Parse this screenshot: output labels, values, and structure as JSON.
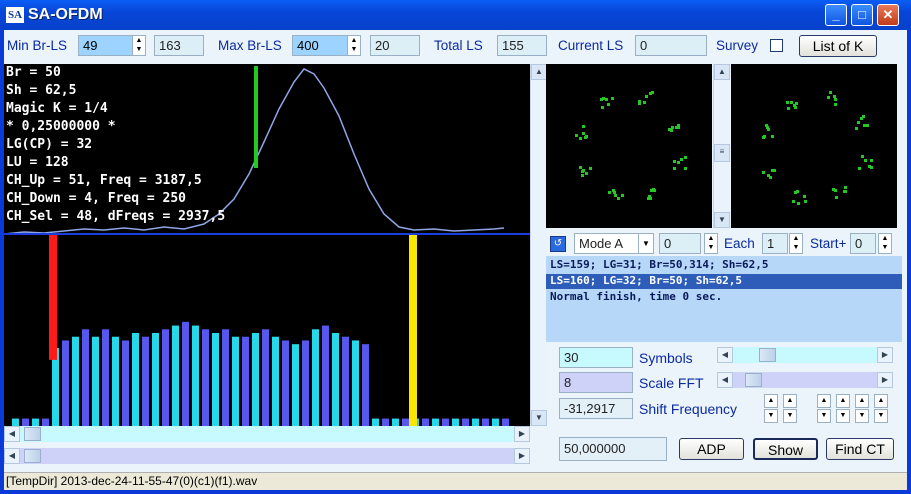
{
  "window": {
    "title": "SA-OFDM",
    "icon_text": "SA",
    "min": "_",
    "max": "□",
    "close": "✕"
  },
  "top": {
    "min_label": "Min Br-LS",
    "min_value": "49",
    "min_aux": "163",
    "max_label": "Max Br-LS",
    "max_value": "400",
    "max_aux": "20",
    "total_label": "Total LS",
    "total_value": "155",
    "current_label": "Current LS",
    "current_value": "0",
    "survey_label": "Survey",
    "list_button": "List of K"
  },
  "info": [
    "Br = 50",
    "Sh = 62,5",
    "Magic K = 1/4",
    "* 0,25000000 *",
    "LG(CP) = 32",
    "LU = 128",
    "CH_Up = 51, Freq = 3187,5",
    "CH_Down = 4, Freq = 250",
    "CH_Sel = 48, dFreqs = 2937,5"
  ],
  "mode": {
    "mode_value": "Mode A",
    "mode_num": "0",
    "each_label": "Each",
    "each_value": "1",
    "start_label": "Start+",
    "start_value": "0"
  },
  "log": [
    "LS=159; LG=31; Br=50,314; Sh=62,5",
    "LS=160; LG=32; Br=50; Sh=62,5",
    "Normal finish, time 0 sec."
  ],
  "controls": {
    "symbols_value": "30",
    "symbols_label": "Symbols",
    "scale_value": "8",
    "scale_label": "Scale FFT",
    "shift_value": "-31,2917",
    "shift_label": "Shift Frequency",
    "bottom_value": "50,000000",
    "adp_button": "ADP",
    "show_button": "Show",
    "findct_button": "Find CT"
  },
  "status": {
    "text": "[TempDir] 2013-dec-24-11-55-47(0)(c1)(f1).wav"
  },
  "chart_data": {
    "type": "bar",
    "values": [
      4,
      4,
      4,
      4,
      42,
      46,
      48,
      52,
      48,
      52,
      48,
      46,
      50,
      48,
      50,
      52,
      54,
      56,
      54,
      52,
      50,
      52,
      48,
      48,
      50,
      52,
      48,
      46,
      44,
      46,
      52,
      54,
      50,
      48,
      46,
      44,
      4,
      4,
      4,
      4,
      4,
      4,
      4,
      4,
      4,
      4,
      4,
      4,
      4,
      4
    ],
    "ylim": [
      0,
      100
    ],
    "markers": {
      "red_index": 4,
      "yellow_index": 40
    },
    "curve": [
      [
        0,
        170
      ],
      [
        20,
        168
      ],
      [
        40,
        169
      ],
      [
        60,
        167
      ],
      [
        80,
        165
      ],
      [
        100,
        166
      ],
      [
        120,
        164
      ],
      [
        140,
        166
      ],
      [
        160,
        163
      ],
      [
        180,
        165
      ],
      [
        200,
        160
      ],
      [
        215,
        150
      ],
      [
        230,
        135
      ],
      [
        245,
        110
      ],
      [
        260,
        78
      ],
      [
        275,
        45
      ],
      [
        290,
        18
      ],
      [
        300,
        5
      ],
      [
        310,
        10
      ],
      [
        320,
        24
      ],
      [
        335,
        52
      ],
      [
        350,
        90
      ],
      [
        365,
        125
      ],
      [
        380,
        150
      ],
      [
        395,
        163
      ],
      [
        410,
        166
      ],
      [
        430,
        165
      ],
      [
        450,
        167
      ],
      [
        470,
        166
      ],
      [
        490,
        165
      ],
      [
        500,
        164
      ]
    ]
  },
  "colors": {
    "bar_a": "#25d8ea",
    "bar_b": "#5757ee",
    "red": "#ff1a1a",
    "yellow": "#f7e600",
    "green": "#22c922",
    "curve": "#8fa6e6"
  }
}
